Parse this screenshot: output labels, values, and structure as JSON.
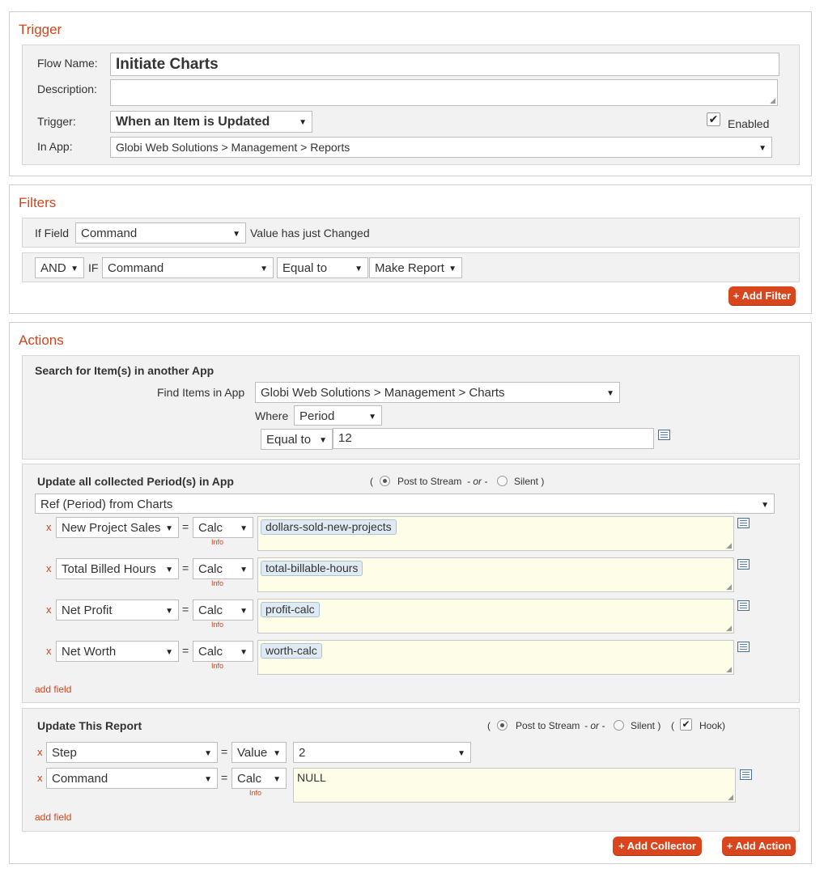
{
  "trigger": {
    "title": "Trigger",
    "flow_name_label": "Flow Name:",
    "flow_name_value": "Initiate Charts",
    "description_label": "Description:",
    "description_value": "",
    "trigger_label": "Trigger:",
    "trigger_value": "When an Item is Updated",
    "enabled_label": "Enabled",
    "in_app_label": "In App:",
    "in_app_value": "Globi Web Solutions > Management > Reports"
  },
  "filters": {
    "title": "Filters",
    "if_field_label": "If Field",
    "field_value": "Command",
    "changed_label": "Value has just Changed",
    "logic_value": "AND",
    "if_label": "IF",
    "cond_field_value": "Command",
    "operator_value": "Equal to",
    "cond_value": "Make Report",
    "add_filter_label": "+ Add Filter"
  },
  "actions": {
    "title": "Actions",
    "search": {
      "title": "Search for Item(s) in another App",
      "find_label": "Find Items in App",
      "app_value": "Globi Web Solutions > Management > Charts",
      "where_label": "Where",
      "where_field": "Period",
      "operator": "Equal to",
      "value": "12"
    },
    "update_collected": {
      "title": "Update all collected Period(s) in App",
      "open_paren": "(",
      "post_label": "Post to Stream",
      "or_label": "- or -",
      "silent_label": "Silent )",
      "ref_value": "Ref (Period) from Charts",
      "rows": [
        {
          "field": "New Project Sales",
          "mode": "Calc",
          "token": "dollars-sold-new-projects"
        },
        {
          "field": "Total Billed Hours",
          "mode": "Calc",
          "token": "total-billable-hours"
        },
        {
          "field": "Net Profit",
          "mode": "Calc",
          "token": "profit-calc"
        },
        {
          "field": "Net Worth",
          "mode": "Calc",
          "token": "worth-calc"
        }
      ],
      "info_label": "Info",
      "remove_label": "x",
      "eq_label": "=",
      "add_field_label": "add field"
    },
    "update_report": {
      "title": "Update This Report",
      "open_paren": "(",
      "post_label": "Post to Stream",
      "or_label": "- or -",
      "silent_label": "Silent )",
      "hook_open": "(",
      "hook_label": "Hook)",
      "rows": [
        {
          "field": "Step",
          "mode": "Value",
          "value": "2"
        },
        {
          "field": "Command",
          "mode": "Calc",
          "value": "NULL"
        }
      ],
      "info_label": "Info",
      "remove_label": "x",
      "eq_label": "=",
      "add_field_label": "add field"
    },
    "add_collector_label": "+ Add Collector",
    "add_action_label": "+ Add Action"
  }
}
